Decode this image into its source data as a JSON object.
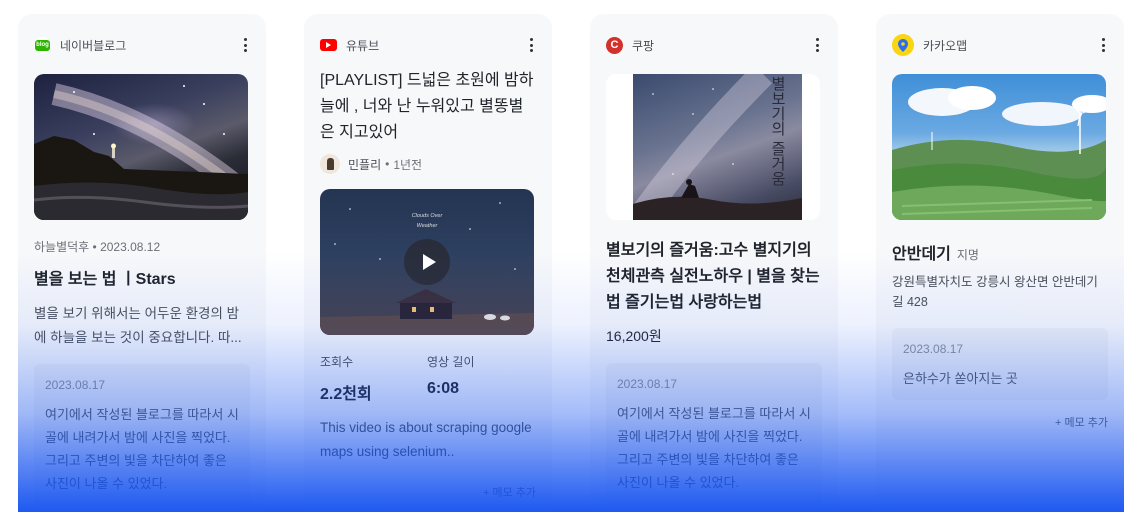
{
  "cards": [
    {
      "source": "네이버블로그",
      "source_logo_text": "blog",
      "meta": "하늘별덕후 • 2023.08.12",
      "title": "별을 보는 법 ㅣStars",
      "desc": "별을 보기 위해서는 어두운 환경의 밤에 하늘을 보는 것이 중요합니다. 따...",
      "memo_date": "2023.08.17",
      "memo_text": "여기에서 작성된 블로그를 따라서 시골에 내려가서 밤에 사진을 찍었다. 그리고 주변의 빛을 차단하여 좋은 사진이 나올 수 있었다."
    },
    {
      "source": "유튜브",
      "title": "[PLAYLIST] 드넓은 초원에 밤하늘에 , 너와 난 누워있고 별똥별은 지고있어",
      "channel": "민플리",
      "ago": "1년전",
      "video_caption_1": "Clouds Over",
      "video_caption_2": "Weather",
      "views_label": "조회수",
      "views_value": "2.2천회",
      "length_label": "영상 길이",
      "length_value": "6:08",
      "desc": "This video is about scraping google maps using selenium..",
      "add_memo": "+ 메모 추가"
    },
    {
      "source": "쿠팡",
      "source_logo_text": "C",
      "book_title": "별보기의 즐거움",
      "title": "별보기의 즐거움:고수 별지기의 천체관측 실전노하우 | 별을 찾는 법 즐기는법 사랑하는법",
      "price": "16,200원",
      "memo_date": "2023.08.17",
      "memo_text": "여기에서 작성된 블로그를 따라서 시골에 내려가서 밤에 사진을 찍었다. 그리고 주변의 빛을 차단하여 좋은 사진이 나올 수 있었다."
    },
    {
      "source": "카카오맵",
      "place": "안반데기",
      "place_type": "지명",
      "address": "강원특별자치도 강릉시 왕산면 안반데기길 428",
      "memo_date": "2023.08.17",
      "memo_text": "은하수가 쏟아지는 곳",
      "add_memo": "+ 메모 추가"
    }
  ],
  "colors": {
    "naver": "#2db400",
    "youtube": "#ff0000",
    "coupang": "#d1322b",
    "kakao": "#fad511",
    "overlay": "#1250f0"
  },
  "icons": [
    "more-vertical-icon",
    "play-icon",
    "map-pin-icon"
  ]
}
